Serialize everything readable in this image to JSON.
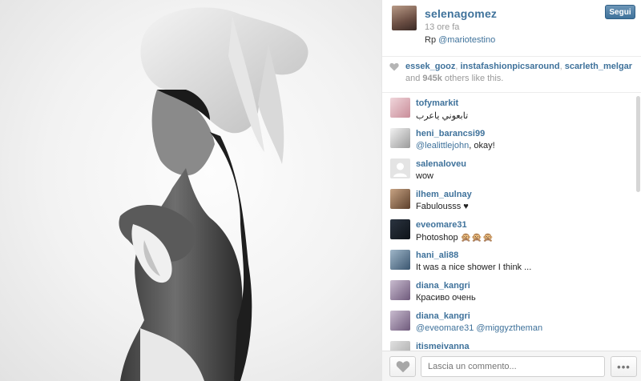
{
  "post": {
    "username": "selenagomez",
    "time_ago": "13 ore fa",
    "caption_prefix": "Rp ",
    "caption_mention": "@mariotestino",
    "follow_label": "Segui"
  },
  "likes": {
    "likers": [
      "essek_gooz",
      "instafashionpicsaround",
      "scarleth_melgar"
    ],
    "separator": ",",
    "others_prefix": "and ",
    "others_count": "945k",
    "others_suffix": " others like this."
  },
  "comments": [
    {
      "user": "tofymarkit",
      "text": "تابعوني ياعرب",
      "avatar_color": "#e8c8cf"
    },
    {
      "user": "heni_barancsi99",
      "mention": "@lealittlejohn",
      "text": ", okay!",
      "avatar_color": "#d8d8d8"
    },
    {
      "user": "salenaloveu",
      "text": "wow",
      "avatar_color": "#e6e6e6"
    },
    {
      "user": "ilhem_aulnay",
      "text": "Fabulousss ♥",
      "avatar_color": "#8a6a4d"
    },
    {
      "user": "eveomare31",
      "text": "Photoshop 🙊🙊🙊",
      "avatar_color": "#1f2630"
    },
    {
      "user": "hani_ali88",
      "text": "It was a nice shower I think ...",
      "avatar_color": "#5d7a93"
    },
    {
      "user": "diana_kangri",
      "text": "Красиво очень",
      "avatar_color": "#9b8aa6"
    },
    {
      "user": "diana_kangri",
      "mention": "@eveomare31 @miggyztheman",
      "text": "",
      "avatar_color": "#9b8aa6"
    },
    {
      "user": "itismeivanna",
      "text": "",
      "avatar_color": "#cfcfcf"
    }
  ],
  "footer": {
    "comment_placeholder": "Lascia un commento...",
    "more_label": "•••"
  },
  "colors": {
    "link": "#3f729b",
    "muted": "#9a9a9a"
  },
  "icons": {
    "like": "heart-icon",
    "more": "more-dots-icon"
  }
}
